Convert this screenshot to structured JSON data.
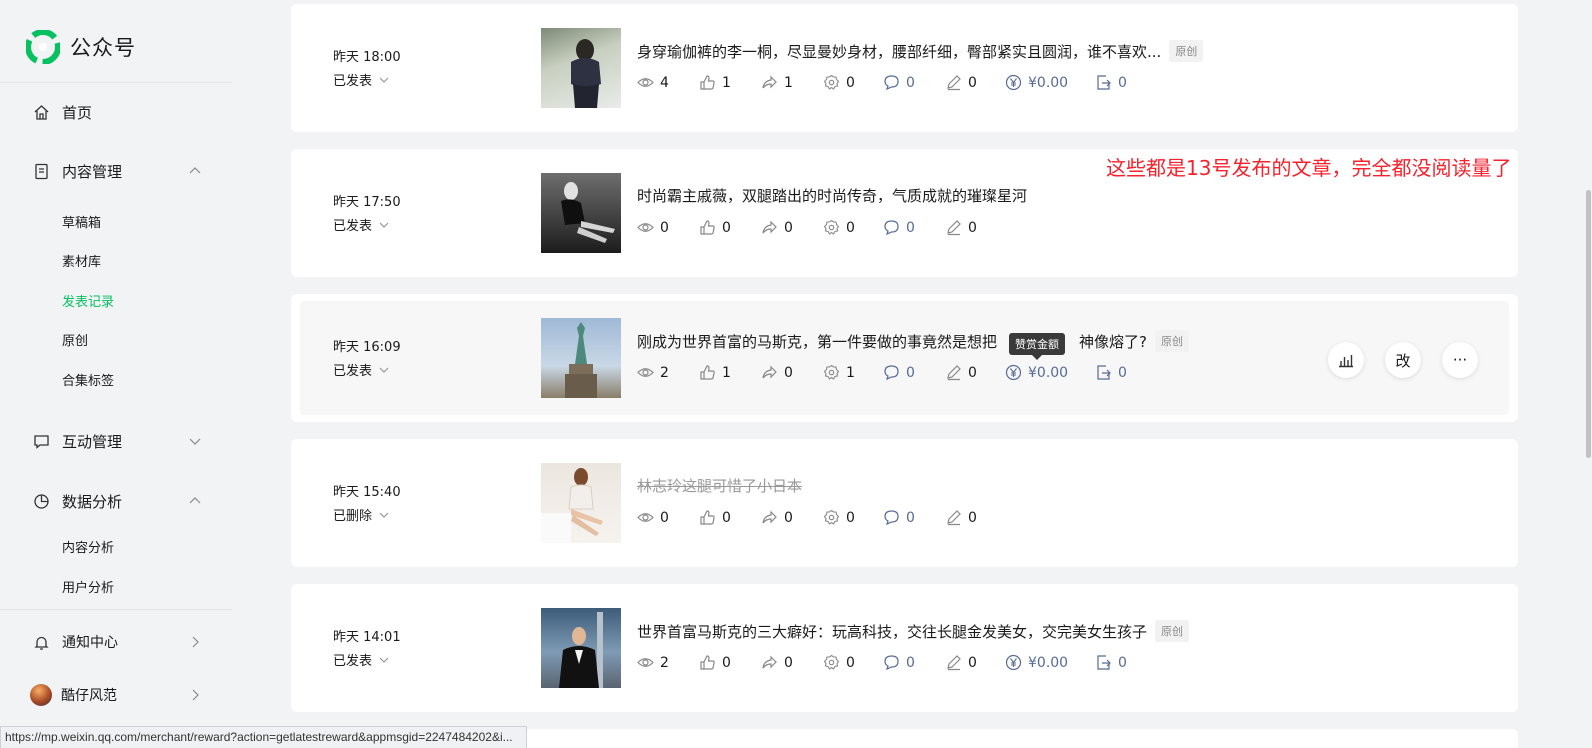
{
  "app": {
    "name": "公众号"
  },
  "sidebar": {
    "home": "首页",
    "content_mgmt": {
      "label": "内容管理",
      "items": [
        "草稿箱",
        "素材库",
        "发表记录",
        "原创",
        "合集标签"
      ]
    },
    "interaction_mgmt": "互动管理",
    "data_analysis": {
      "label": "数据分析",
      "items": [
        "内容分析",
        "用户分析"
      ]
    },
    "notifications": "通知中心",
    "account": "酷仔风范"
  },
  "articles": [
    {
      "time": "昨天 18:00",
      "status": "已发表",
      "title": "身穿瑜伽裤的李一桐，尽显曼妙身材，腰部纤细，臀部紧实且圆润，谁不喜欢...",
      "tag": "原创",
      "stats": {
        "views": "4",
        "likes": "1",
        "shares": "1",
        "wow": "0",
        "comments": "0",
        "edits": "0",
        "reward": "¥0.00",
        "forwards": "0"
      }
    },
    {
      "time": "昨天 17:50",
      "status": "已发表",
      "title": "时尚霸主戚薇，双腿踏出的时尚传奇，气质成就的璀璨星河",
      "tag": "",
      "stats": {
        "views": "0",
        "likes": "0",
        "shares": "0",
        "wow": "0",
        "comments": "0",
        "edits": "0"
      }
    },
    {
      "time": "昨天 16:09",
      "status": "已发表",
      "title": "刚成为世界首富的马斯克，第一件要做的事竟然是想把",
      "title_tail": "神像熔了?",
      "tag": "原创",
      "tooltip": "赞赏金额",
      "stats": {
        "views": "2",
        "likes": "1",
        "shares": "0",
        "wow": "1",
        "comments": "0",
        "edits": "0",
        "reward": "¥0.00",
        "forwards": "0"
      },
      "actions": {
        "edit": "改",
        "more": "···"
      }
    },
    {
      "time": "昨天 15:40",
      "status": "已删除",
      "title": "林志玲这腿可惜了小日本",
      "tag": "",
      "stats": {
        "views": "0",
        "likes": "0",
        "shares": "0",
        "wow": "0",
        "comments": "0",
        "edits": "0"
      }
    },
    {
      "time": "昨天 14:01",
      "status": "已发表",
      "title": "世界首富马斯克的三大癖好：玩高科技，交往长腿金发美女，交完美女生孩子",
      "tag": "原创",
      "stats": {
        "views": "2",
        "likes": "0",
        "shares": "0",
        "wow": "0",
        "comments": "0",
        "edits": "0",
        "reward": "¥0.00",
        "forwards": "0"
      }
    }
  ],
  "annotation": "这些都是13号发布的文章，完全都没阅读量了",
  "status_url": "https://mp.weixin.qq.com/merchant/reward?action=getlatestreward&appmsgid=2247484202&i...",
  "colors": {
    "accent": "#07c160",
    "link_blue": "#576b95",
    "annotation_red": "#f5222d"
  }
}
